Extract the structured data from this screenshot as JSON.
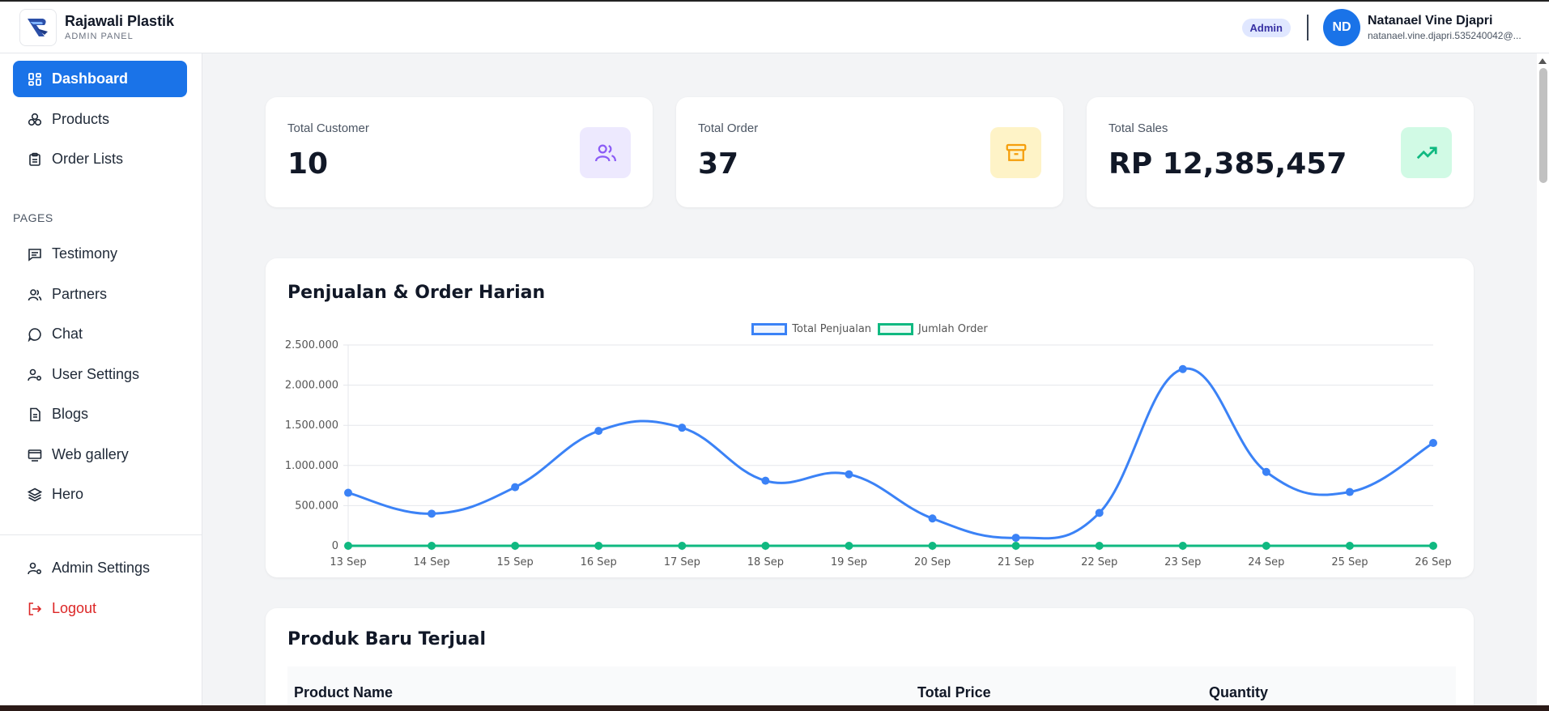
{
  "brand": {
    "name": "Rajawali Plastik",
    "subtitle": "ADMIN PANEL"
  },
  "user": {
    "role": "Admin",
    "initials": "ND",
    "name": "Natanael Vine Djapri",
    "email": "natanael.vine.djapri.535240042@..."
  },
  "sidebar": {
    "main_items": [
      {
        "label": "Dashboard",
        "icon": "dashboard-icon",
        "active": true
      },
      {
        "label": "Products",
        "icon": "products-icon"
      },
      {
        "label": "Order Lists",
        "icon": "clipboard-icon"
      }
    ],
    "pages_label": "PAGES",
    "page_items": [
      {
        "label": "Testimony",
        "icon": "message-square-icon"
      },
      {
        "label": "Partners",
        "icon": "users-icon"
      },
      {
        "label": "Chat",
        "icon": "chat-icon"
      },
      {
        "label": "User Settings",
        "icon": "user-cog-icon"
      },
      {
        "label": "Blogs",
        "icon": "document-icon"
      },
      {
        "label": "Web gallery",
        "icon": "monitor-icon"
      },
      {
        "label": "Hero",
        "icon": "layers-icon"
      }
    ],
    "bottom_items": [
      {
        "label": "Admin Settings",
        "icon": "user-cog-icon"
      },
      {
        "label": "Logout",
        "icon": "logout-icon"
      }
    ]
  },
  "stats": [
    {
      "label": "Total Customer",
      "value": "10",
      "icon": "users-icon",
      "icon_color": "#8b5cf6",
      "icon_bg": "#ede9fe"
    },
    {
      "label": "Total Order",
      "value": "37",
      "icon": "archive-box-icon",
      "icon_color": "#f59e0b",
      "icon_bg": "#fef3c7"
    },
    {
      "label": "Total Sales",
      "value": "RP 12,385,457",
      "icon": "trending-up-icon",
      "icon_color": "#10b981",
      "icon_bg": "#d1fae5"
    }
  ],
  "chart_section": {
    "title": "Penjualan & Order Harian"
  },
  "chart_data": {
    "type": "line",
    "categories": [
      "13 Sep",
      "14 Sep",
      "15 Sep",
      "16 Sep",
      "17 Sep",
      "18 Sep",
      "19 Sep",
      "20 Sep",
      "21 Sep",
      "22 Sep",
      "23 Sep",
      "24 Sep",
      "25 Sep",
      "26 Sep"
    ],
    "series": [
      {
        "name": "Total Penjualan",
        "color": "#3b82f6",
        "values": [
          660000,
          400000,
          730000,
          1430000,
          1470000,
          810000,
          890000,
          340000,
          100000,
          410000,
          2200000,
          920000,
          670000,
          1280000
        ]
      },
      {
        "name": "Jumlah Order",
        "color": "#10b981",
        "values": [
          3,
          2,
          3,
          4,
          3,
          2,
          3,
          2,
          1,
          2,
          5,
          3,
          2,
          2
        ]
      }
    ],
    "y_ticks": [
      "0",
      "500.000",
      "1.000.000",
      "1.500.000",
      "2.000.000",
      "2.500.000"
    ],
    "ylim": [
      0,
      2500000
    ],
    "legend_position": "top-center",
    "grid": true
  },
  "products_section": {
    "title": "Produk Baru Terjual",
    "columns": [
      "Product Name",
      "Total Price",
      "Quantity"
    ]
  }
}
